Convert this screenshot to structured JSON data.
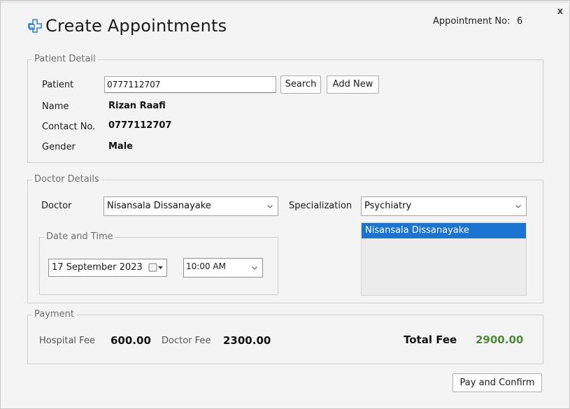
{
  "window": {
    "title": "Create Appointments",
    "close_label": "x"
  },
  "appointment": {
    "label": "Appointment No:",
    "number": "6"
  },
  "patient_detail": {
    "legend": "Patient Detail",
    "patient_label": "Patient",
    "patient_value": "0777112707",
    "search_label": "Search",
    "add_new_label": "Add New",
    "name_label": "Name",
    "name_value": "Rizan Raafi",
    "contact_label": "Contact No.",
    "contact_value": "0777112707",
    "gender_label": "Gender",
    "gender_value": "Male"
  },
  "doctor_details": {
    "legend": "Doctor Details",
    "doctor_label": "Doctor",
    "doctor_value": "Nisansala Dissanayake",
    "specialization_label": "Specialization",
    "specialization_value": "Psychiatry",
    "doctor_list": [
      "Nisansala Dissanayake"
    ],
    "date_time": {
      "legend": "Date and Time",
      "date_value": "17 September 2023",
      "time_value": "10:00 AM"
    }
  },
  "payment": {
    "legend": "Payment",
    "hospital_fee_label": "Hospital Fee",
    "hospital_fee_value": "600.00",
    "doctor_fee_label": "Doctor Fee",
    "doctor_fee_value": "2300.00",
    "total_fee_label": "Total Fee",
    "total_fee_value": "2900.00"
  },
  "actions": {
    "pay_confirm_label": "Pay and Confirm"
  },
  "colors": {
    "accent_blue": "#1a74d0",
    "total_green": "#4e8a3a",
    "title_icon": "#2f7fd0"
  },
  "icons": {
    "title": "medical-cross-icon",
    "close": "close-icon",
    "dropdown": "chevron-down-icon",
    "calendar": "calendar-icon"
  }
}
